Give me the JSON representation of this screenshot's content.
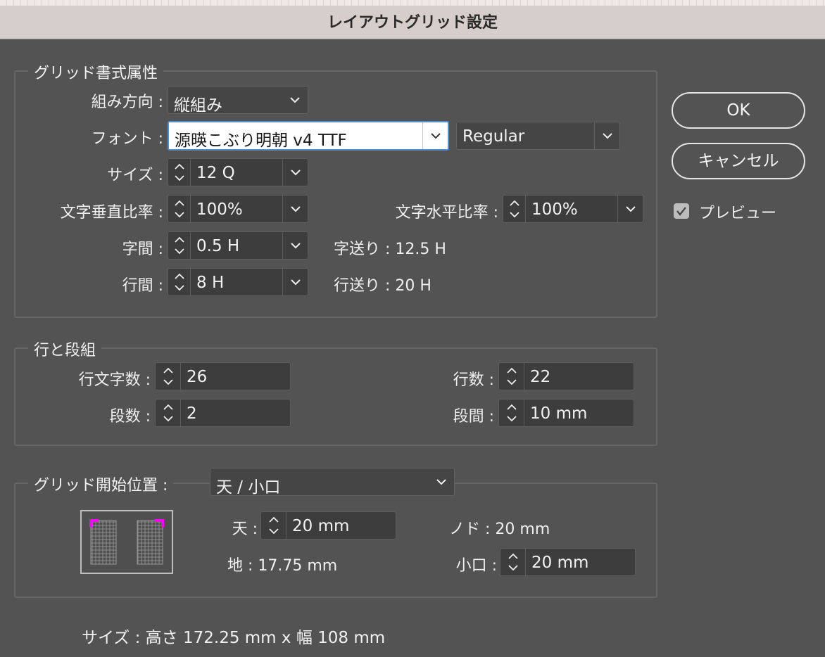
{
  "dialog": {
    "title": "レイアウトグリッド設定"
  },
  "buttons": {
    "ok": "OK",
    "cancel": "キャンセル"
  },
  "preview": {
    "label": "プレビュー",
    "checked": true
  },
  "grid_format": {
    "legend": "グリッド書式属性",
    "direction_label": "組み方向 :",
    "direction_value": "縦組み",
    "font_label": "フォント :",
    "font_family": "源暎こぶり明朝 v4 TTF",
    "font_style": "Regular",
    "size_label": "サイズ :",
    "size_value": "12 Q",
    "vscale_label": "文字垂直比率 :",
    "vscale_value": "100%",
    "hscale_label": "文字水平比率 :",
    "hscale_value": "100%",
    "char_spacing_label": "字間 :",
    "char_spacing_value": "0.5 H",
    "char_advance": "字送り : 12.5 H",
    "line_spacing_label": "行間 :",
    "line_spacing_value": "8 H",
    "line_advance": "行送り : 20 H"
  },
  "lines_columns": {
    "legend": "行と段組",
    "chars_per_line_label": "行文字数 :",
    "chars_per_line_value": "26",
    "lines_label": "行数 :",
    "lines_value": "22",
    "columns_label": "段数 :",
    "columns_value": "2",
    "gutter_label": "段間 :",
    "gutter_value": "10 mm"
  },
  "start_position": {
    "legend": "グリッド開始位置 :",
    "value": "天 / 小口",
    "top_label": "天 :",
    "top_value": "20 mm",
    "inside": "ノド : 20 mm",
    "bottom": "地 : 17.75 mm",
    "outside_label": "小口 :",
    "outside_value": "20 mm"
  },
  "size_summary": "サイズ : 高さ 172.25 mm x 幅 108 mm",
  "colors": {
    "accent": "#ff00ff",
    "focus": "#4d90d6"
  }
}
